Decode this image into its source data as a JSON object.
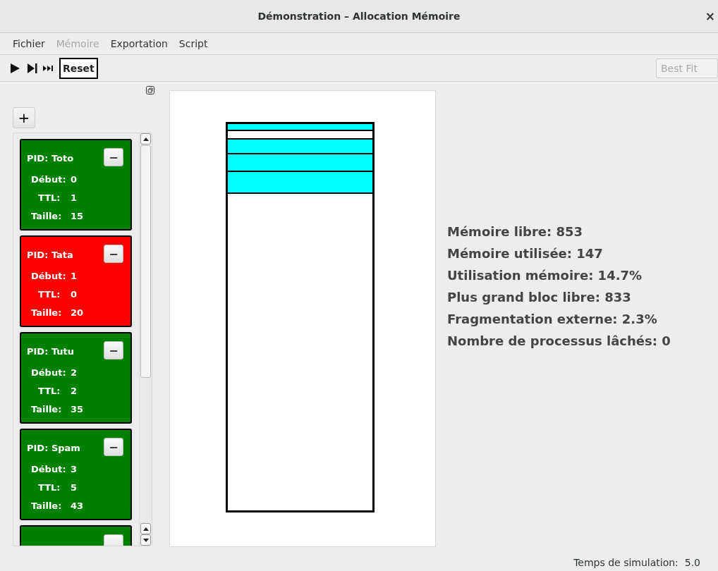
{
  "window": {
    "title": "Démonstration – Allocation Mémoire",
    "close": "×"
  },
  "menu": [
    {
      "label": "Fichier",
      "disabled": false
    },
    {
      "label": "Mémoire",
      "disabled": true
    },
    {
      "label": "Exportation",
      "disabled": false
    },
    {
      "label": "Script",
      "disabled": false
    }
  ],
  "toolbar": {
    "reset": "Reset",
    "algorithm": {
      "value": "Best Fit",
      "disabled": true
    }
  },
  "add_button": "+",
  "processes": [
    {
      "pid": "PID: Toto",
      "remove": "−",
      "color": "#008000",
      "fields": [
        {
          "label": "Début:",
          "value": "0"
        },
        {
          "label": "TTL:",
          "value": "1"
        },
        {
          "label": "Taille:",
          "value": "15"
        }
      ]
    },
    {
      "pid": "PID: Tata",
      "remove": "−",
      "color": "#ff0000",
      "fields": [
        {
          "label": "Début:",
          "value": "1"
        },
        {
          "label": "TTL:",
          "value": "0"
        },
        {
          "label": "Taille:",
          "value": "20"
        }
      ]
    },
    {
      "pid": "PID: Tutu",
      "remove": "−",
      "color": "#008000",
      "fields": [
        {
          "label": "Début:",
          "value": "2"
        },
        {
          "label": "TTL:",
          "value": "2"
        },
        {
          "label": "Taille:",
          "value": "35"
        }
      ]
    },
    {
      "pid": "PID: Spam",
      "remove": "−",
      "color": "#008000",
      "fields": [
        {
          "label": "Début:",
          "value": "3"
        },
        {
          "label": "TTL:",
          "value": "5"
        },
        {
          "label": "Taille:",
          "value": "43"
        }
      ]
    },
    {
      "color": "#008000"
    }
  ],
  "memory_blocks": [
    {
      "allocated": true
    },
    {
      "allocated": false
    },
    {
      "allocated": true
    },
    {
      "allocated": true
    },
    {
      "allocated": true
    }
  ],
  "stats": [
    "Mémoire libre: 853",
    "Mémoire utilisée: 147",
    "Utilisation mémoire: 14.7%",
    "Plus grand bloc libre: 833",
    "Fragmentation externe: 2.3%",
    "Nombre de processus lâchés: 0"
  ],
  "status_bar": "Temps de simulation:  5.0"
}
